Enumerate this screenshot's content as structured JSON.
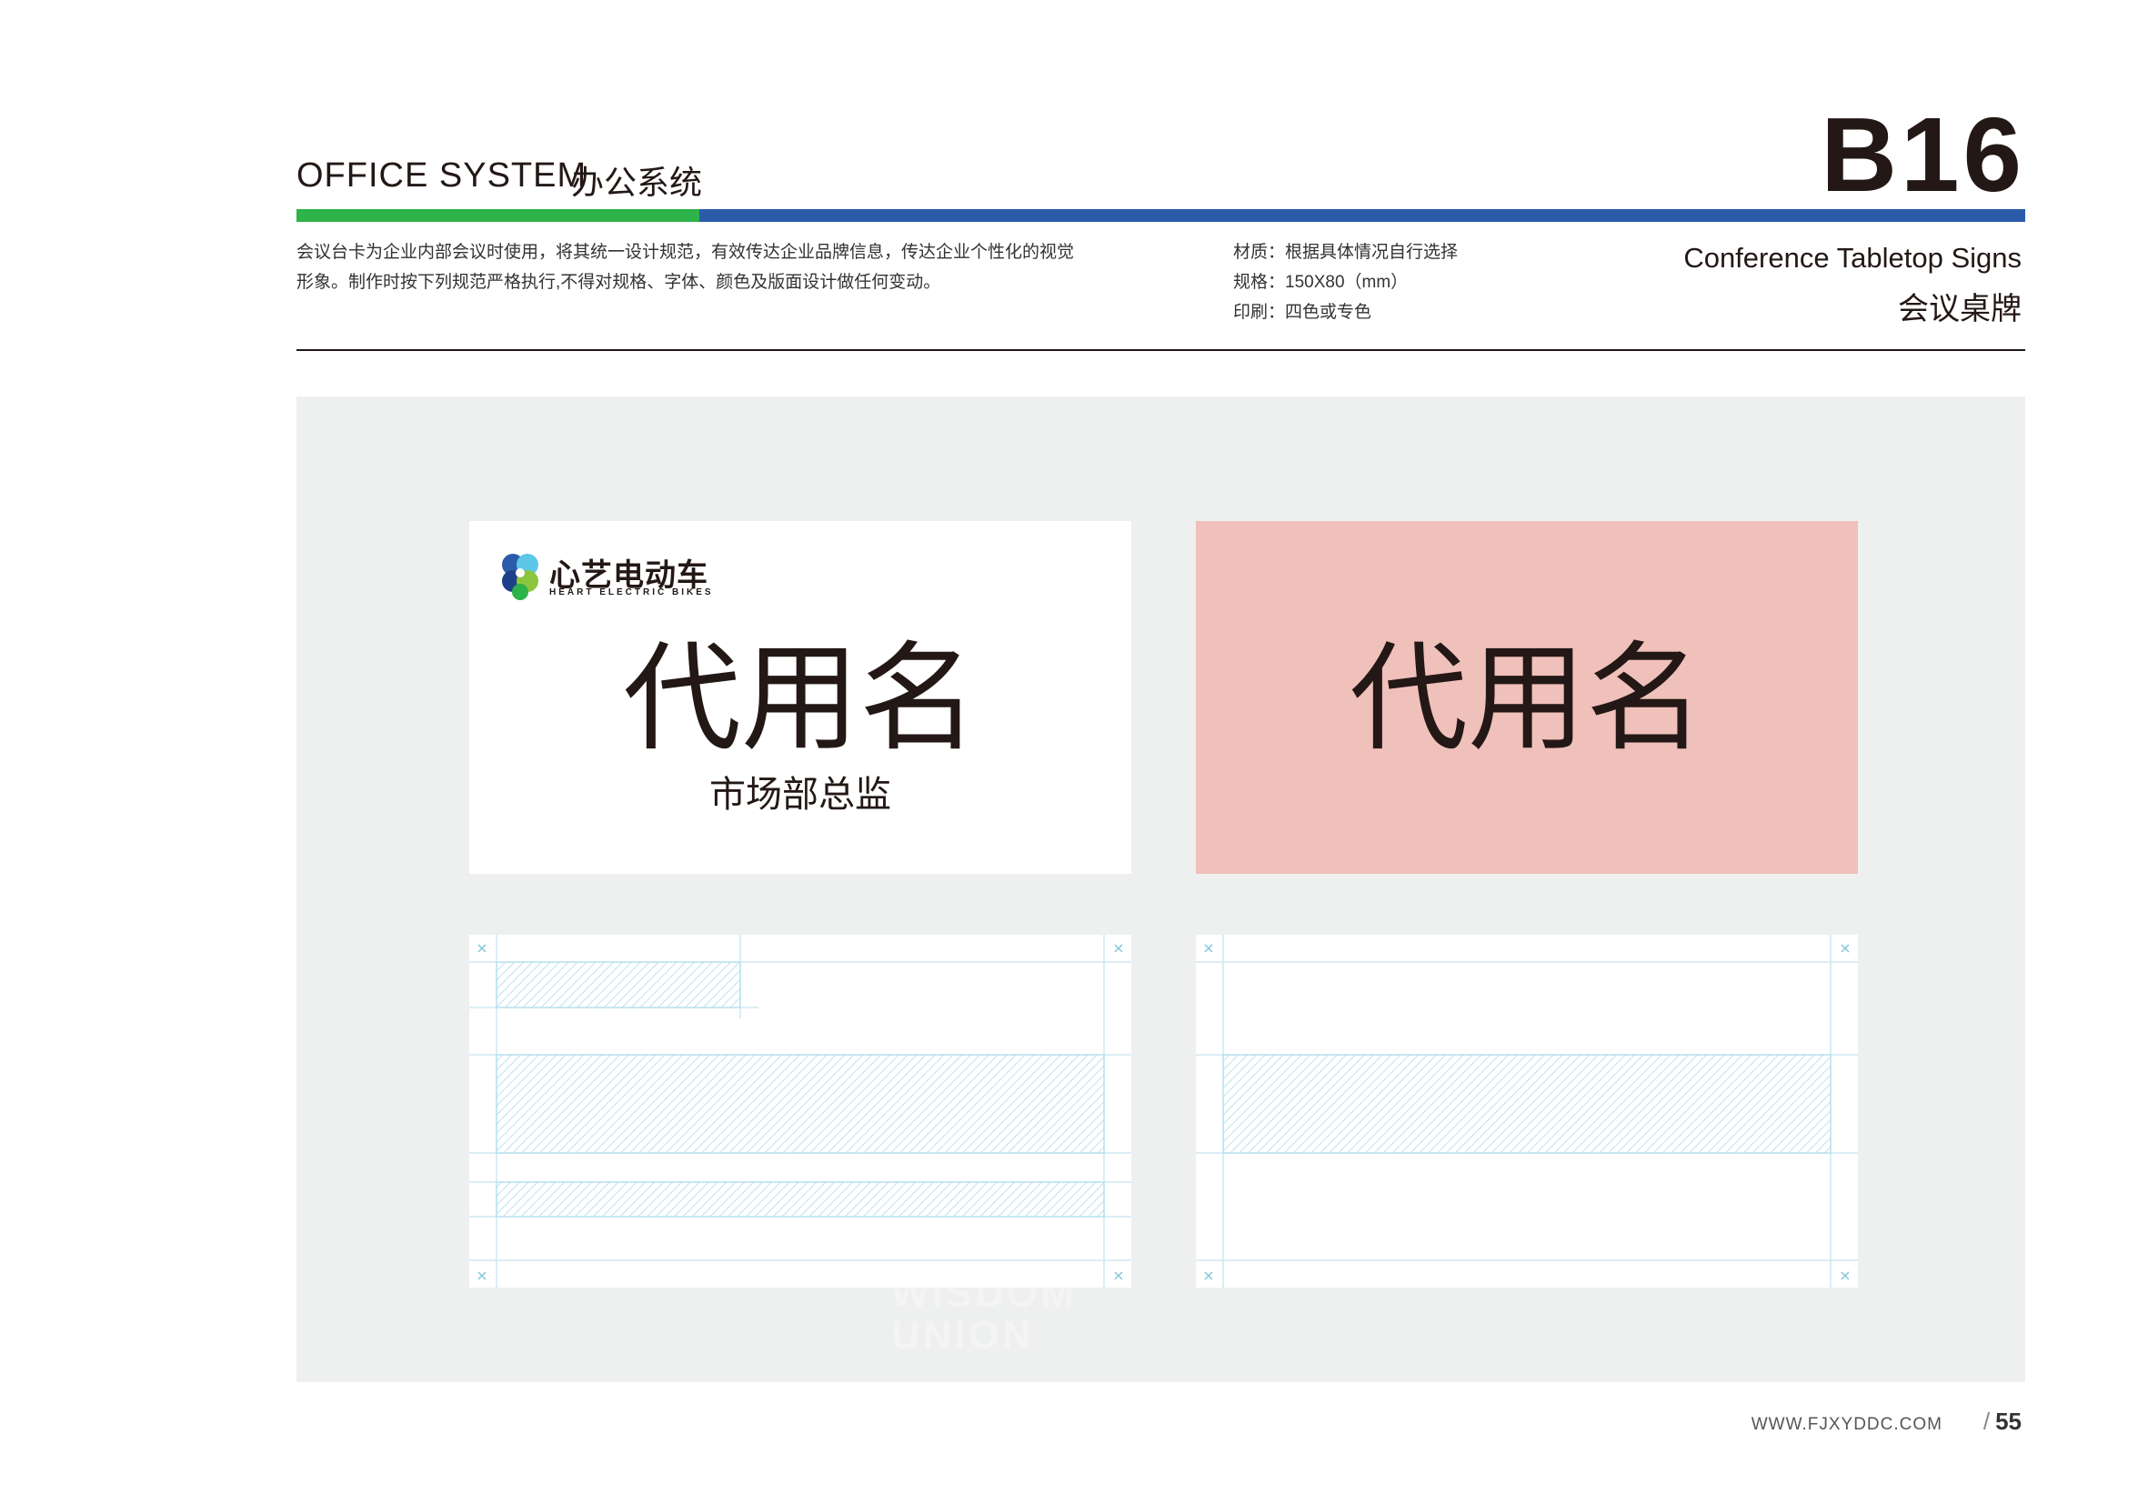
{
  "header": {
    "section_en": "OFFICE SYSTEM",
    "section_cn": "办公系统",
    "page_code": "B16",
    "description": [
      "会议台卡为企业内部会议时使用，将其统一设计规范，有效传达企业品牌信息，传达企业个性化的视觉",
      "形象。制作时按下列规范严格执行,不得对规格、字体、颜色及版面设计做任何变动。"
    ],
    "specs": {
      "material": "材质：根据具体情况自行选择",
      "size": "规格：150X80（mm）",
      "print": "印刷：四色或专色"
    },
    "title_en": "Conference Tabletop Signs",
    "title_cn": "会议桌牌"
  },
  "colors": {
    "green": "#2eb24a",
    "blue": "#2a5caa",
    "pink": "#f0c0bb",
    "canvas": "#eef0ef",
    "guide": "#a9dcec"
  },
  "card_white": {
    "logo": {
      "name_cn": "心艺电动车",
      "name_en": "HEART ELECTRIC BIKES",
      "icon": "four-leaf-clover-icon"
    },
    "name": "代用名",
    "role": "市场部总监"
  },
  "card_pink": {
    "name": "代用名"
  },
  "grid": {
    "corner_mark": "×"
  },
  "footer": {
    "site": "WWW.FJXYDDC.COM",
    "slash": "/",
    "page_number": "55"
  }
}
